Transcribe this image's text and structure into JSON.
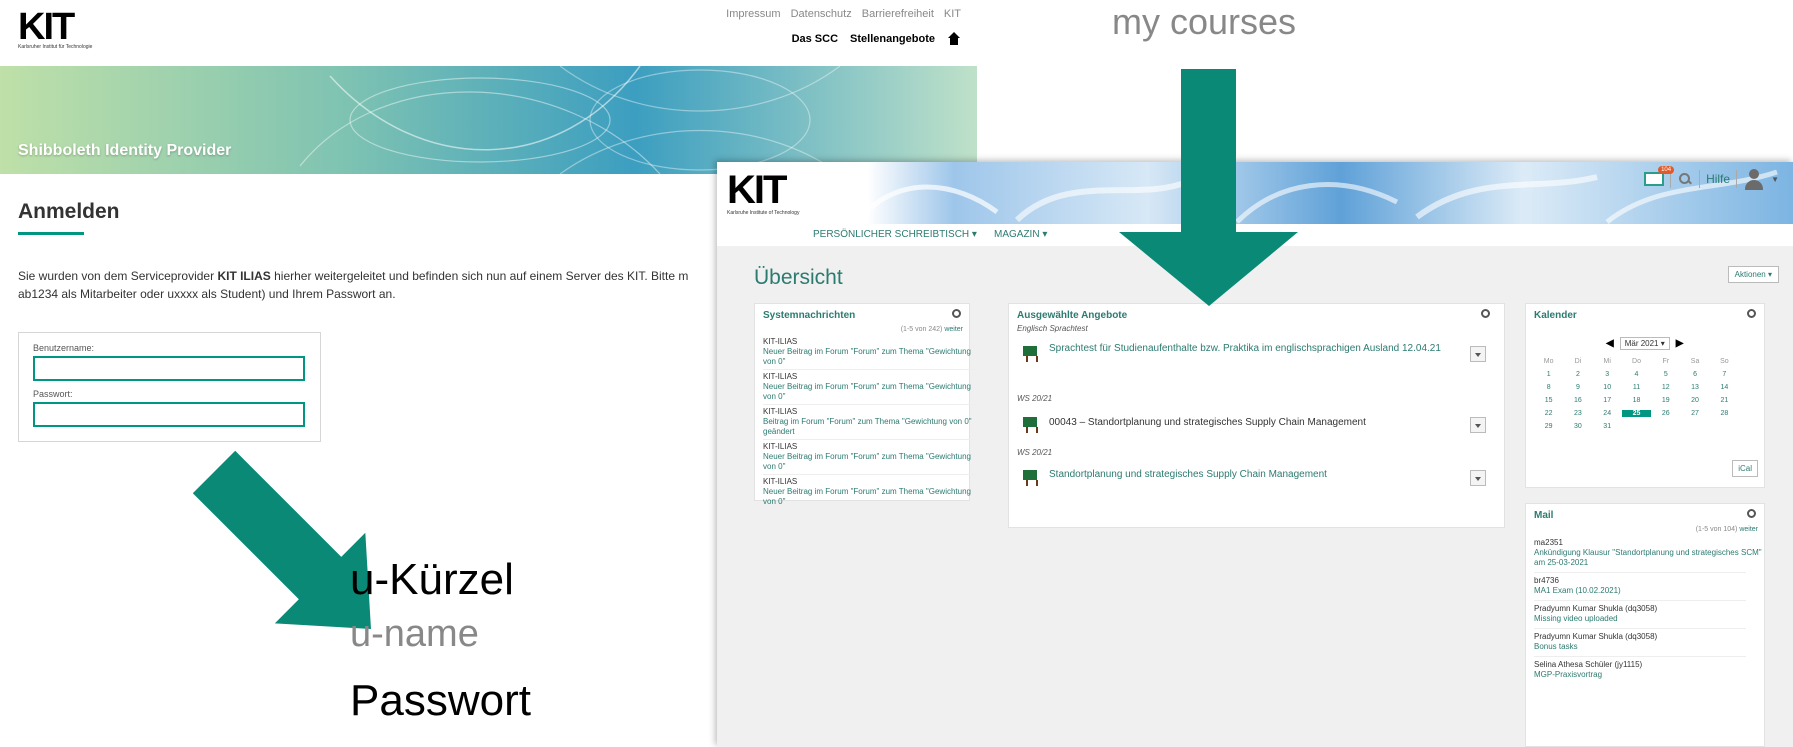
{
  "shib": {
    "logo_text": "KIT",
    "logo_sub": "Karlsruher Institut für Technologie",
    "top_links": [
      "Impressum",
      "Datenschutz",
      "Barrierefreiheit",
      "KIT"
    ],
    "nav_links": [
      "Das SCC",
      "Stellenangebote"
    ],
    "banner_title": "Shibboleth Identity Provider",
    "heading": "Anmelden",
    "intro_pre": "Sie wurden von dem Serviceprovider ",
    "intro_bold": "KIT ILIAS",
    "intro_post": " hierher weitergeleitet und befinden sich nun auf einem Server des KIT. Bitte m",
    "intro_line2": "ab1234 als Mitarbeiter oder uxxxx als Student) und Ihrem Passwort an.",
    "username_label": "Benutzername:",
    "password_label": "Passwort:"
  },
  "ilias": {
    "logo_text": "KIT",
    "logo_sub": "Karlsruhe Institute of Technology",
    "mail_count": "104",
    "help_label": "Hilfe",
    "nav": [
      "PERSÖNLICHER SCHREIBTISCH ▾",
      "MAGAZIN ▾"
    ],
    "title": "Übersicht",
    "actions_label": "Aktionen ▾",
    "system": {
      "title": "Systemnachrichten",
      "count": "(1-5 von 242) ",
      "more": "weiter",
      "items": [
        {
          "sender": "KIT-ILIAS",
          "text": "Neuer Beitrag im Forum \"Forum\" zum Thema \"Gewichtung von 0\""
        },
        {
          "sender": "KIT-ILIAS",
          "text": "Neuer Beitrag im Forum \"Forum\" zum Thema \"Gewichtung von 0\""
        },
        {
          "sender": "KIT-ILIAS",
          "text": "Beitrag im Forum \"Forum\" zum Thema \"Gewichtung von 0\" geändert"
        },
        {
          "sender": "KIT-ILIAS",
          "text": "Neuer Beitrag im Forum \"Forum\" zum Thema \"Gewichtung von 0\""
        },
        {
          "sender": "KIT-ILIAS",
          "text": "Neuer Beitrag im Forum \"Forum\" zum Thema \"Gewichtung von 0\""
        }
      ]
    },
    "offers": {
      "title": "Ausgewählte Angebote",
      "groups": [
        {
          "sub": "Englisch Sprachtest",
          "course": "Sprachtest für Studienaufenthalte bzw. Praktika im englischsprachigen Ausland 12.04.21"
        },
        {
          "sub": "WS 20/21",
          "course": "00043 – Standortplanung und strategisches Supply Chain Management"
        },
        {
          "sub": "WS 20/21",
          "course": "Standortplanung und strategisches Supply Chain Management"
        }
      ]
    },
    "calendar": {
      "title": "Kalender",
      "month": "Mär 2021 ▾",
      "weekdays": [
        "Mo",
        "Di",
        "Mi",
        "Do",
        "Fr",
        "Sa",
        "So"
      ],
      "weeks": [
        [
          "1",
          "2",
          "3",
          "4",
          "5",
          "6",
          "7"
        ],
        [
          "8",
          "9",
          "10",
          "11",
          "12",
          "13",
          "14"
        ],
        [
          "15",
          "16",
          "17",
          "18",
          "19",
          "20",
          "21"
        ],
        [
          "22",
          "23",
          "24",
          "25",
          "26",
          "27",
          "28"
        ],
        [
          "29",
          "30",
          "31",
          "",
          "",
          "",
          ""
        ]
      ],
      "today": "25",
      "ical_label": "iCal"
    },
    "mail": {
      "title": "Mail",
      "count": "(1-5 von 104) ",
      "more": "weiter",
      "items": [
        {
          "sender": "ma2351",
          "subject": "Ankündigung Klausur \"Standortplanung und strategisches SCM\" am 25-03-2021"
        },
        {
          "sender": "br4736",
          "subject": "MA1 Exam (10.02.2021)"
        },
        {
          "sender": "Pradyumn Kumar Shukla (dq3058)",
          "subject": "Missing video uploaded"
        },
        {
          "sender": "Pradyumn Kumar Shukla (dq3058)",
          "subject": "Bonus tasks"
        },
        {
          "sender": "Selina Athesa Schüler (jy1115)",
          "subject": "MGP-Praxisvortrag"
        }
      ]
    }
  },
  "annotations": {
    "my_courses": "my courses",
    "u_kuerzel": "u-Kürzel",
    "u_name": "u-name",
    "passwort": "Passwort",
    "arrow_color": "#0a8a76"
  }
}
